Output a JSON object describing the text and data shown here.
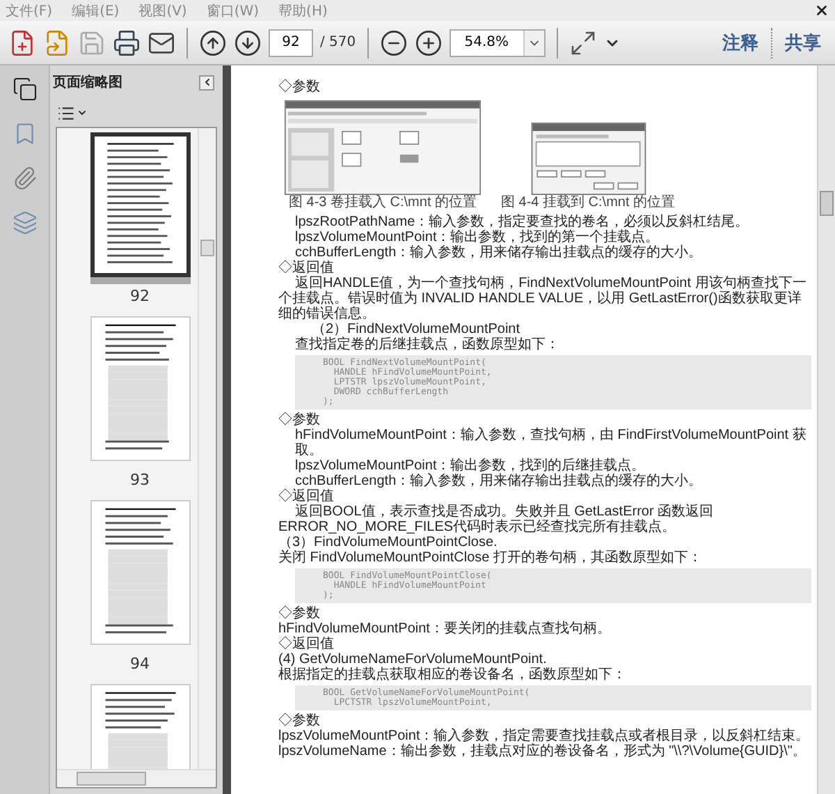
{
  "menu": [
    {
      "label": "文件(F)"
    },
    {
      "label": "编辑(E)"
    },
    {
      "label": "视图(V)"
    },
    {
      "label": "窗口(W)"
    },
    {
      "label": "帮助(H)"
    }
  ],
  "toolbar": {
    "page_number": "92",
    "page_total": "/ 570",
    "zoom": "54.8%",
    "comment": "注释",
    "share": "共享"
  },
  "sidebar": {
    "title": "页面缩略图",
    "thumbnails": [
      {
        "label": "92",
        "selected": true
      },
      {
        "label": "93",
        "selected": false
      },
      {
        "label": "94",
        "selected": false
      }
    ]
  },
  "document": [
    {
      "kind": "section",
      "text": "◇参数"
    },
    {
      "kind": "figures",
      "items": [
        {
          "kind": "explorer",
          "caption": "图 4-3  卷挂载入 C:\\mnt 的位置"
        },
        {
          "kind": "dialog",
          "caption": "图 4-4  挂载到 C:\\mnt 的位置"
        }
      ]
    },
    {
      "kind": "indent",
      "text": "lpszRootPathName：输入参数，指定要查找的卷名，必须以反斜杠结尾。"
    },
    {
      "kind": "indent",
      "text": "lpszVolumeMountPoint：输出参数，找到的第一个挂载点。"
    },
    {
      "kind": "indent",
      "text": "cchBufferLength：输入参数，用来储存输出挂载点的缓存的大小。"
    },
    {
      "kind": "section",
      "text": "◇返回值"
    },
    {
      "kind": "para",
      "text": "返回HANDLE值，为一个查找句柄，FindNextVolumeMountPoint 用该句柄查找下一个挂载点。错误时值为 INVALID HANDLE VALUE，以用 GetLastError()函数获取更详细的错误信息。"
    },
    {
      "kind": "subhead",
      "text": "（2）FindNextVolumeMountPoint"
    },
    {
      "kind": "indent",
      "text": "查找指定卷的后继挂载点，函数原型如下："
    },
    {
      "kind": "code",
      "lines": [
        "BOOL FindNextVolumeMountPoint(",
        "  HANDLE hFindVolumeMountPoint,",
        "  LPTSTR lpszVolumeMountPoint,",
        "  DWORD cchBufferLength",
        ");"
      ]
    },
    {
      "kind": "section",
      "text": "◇参数"
    },
    {
      "kind": "indent",
      "text": "hFindVolumeMountPoint：输入参数，查找句柄，由 FindFirstVolumeMountPoint 获取。"
    },
    {
      "kind": "indent",
      "text": "lpszVolumeMountPoint：输出参数，找到的后继挂载点。"
    },
    {
      "kind": "indent",
      "text": "cchBufferLength：输入参数，用来储存输出挂载点的缓存的大小。"
    },
    {
      "kind": "section",
      "text": "◇返回值"
    },
    {
      "kind": "para",
      "text": "返回BOOL值，表示查找是否成功。失败并且 GetLastError 函数返回 ERROR_NO_MORE_FILES代码时表示已经查找完所有挂载点。"
    },
    {
      "kind": "flat",
      "text": "（3）FindVolumeMountPointClose."
    },
    {
      "kind": "flat",
      "text": "关闭 FindVolumeMountPointClose 打开的卷句柄，其函数原型如下："
    },
    {
      "kind": "code",
      "lines": [
        "BOOL FindVolumeMountPointClose(",
        "  HANDLE hFindVolumeMountPoint",
        ");"
      ]
    },
    {
      "kind": "section",
      "text": "◇参数"
    },
    {
      "kind": "flat",
      "text": "hFindVolumeMountPoint：要关闭的挂载点查找句柄。"
    },
    {
      "kind": "section",
      "text": "◇返回值"
    },
    {
      "kind": "flat",
      "text": "(4) GetVolumeNameForVolumeMountPoint."
    },
    {
      "kind": "flat",
      "text": "根据指定的挂载点获取相应的卷设备名，函数原型如下："
    },
    {
      "kind": "code",
      "lines": [
        "BOOL GetVolumeNameForVolumeMountPoint(",
        "  LPCTSTR lpszVolumeMountPoint,"
      ]
    },
    {
      "kind": "section",
      "text": "◇参数"
    },
    {
      "kind": "flat",
      "text": "lpszVolumeMountPoint：输入参数，指定需要查找挂载点或者根目录，以反斜杠结束。"
    },
    {
      "kind": "flat",
      "text": "lpszVolumeName：输出参数，挂载点对应的卷设备名，形式为 \"\\\\?\\Volume{GUID}\\\"。"
    }
  ]
}
